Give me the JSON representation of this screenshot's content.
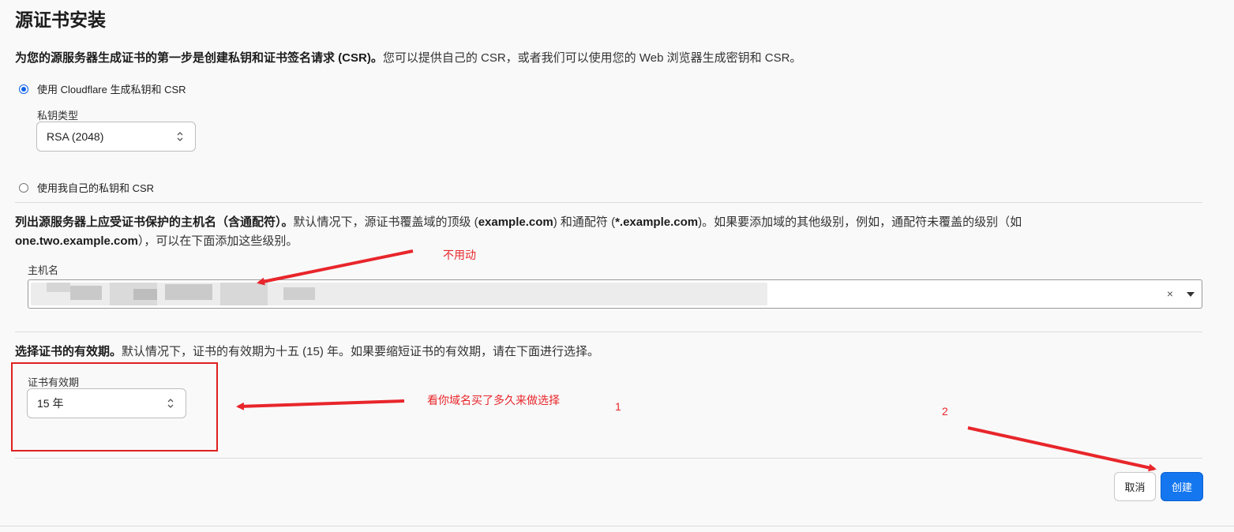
{
  "page": {
    "title": "源证书安装"
  },
  "csr_section": {
    "desc_bold": "为您的源服务器生成证书的第一步是创建私钥和证书签名请求 (CSR)。",
    "desc_rest": "您可以提供自己的 CSR，或者我们可以使用您的 Web 浏览器生成密钥和 CSR。",
    "option_generate": "使用 Cloudflare 生成私钥和 CSR",
    "option_generate_checked": true,
    "key_type_label": "私钥类型",
    "key_type_value": "RSA (2048)",
    "option_own": "使用我自己的私钥和 CSR",
    "option_own_checked": false
  },
  "hostname_section": {
    "desc_bold": "列出源服务器上应受证书保护的主机名（含通配符）。",
    "desc_rest_1": "默认情况下，源证书覆盖域的顶级 (",
    "example_root": "example.com",
    "desc_rest_2": ") 和通配符 (",
    "example_wildcard": "*.example.com",
    "desc_rest_3": ")。如果要添加域的其他级别，例如，通配符未覆盖的级别（如",
    "example_sub": "one.two.example.com",
    "desc_rest_4": "），可以在下面添加这些级别。",
    "field_label": "主机名",
    "clear_glyph": "×"
  },
  "validity_section": {
    "desc_bold": "选择证书的有效期。",
    "desc_rest": "默认情况下，证书的有效期为十五 (15) 年。如果要缩短证书的有效期，请在下面进行选择。",
    "field_label": "证书有效期",
    "value": "15 年"
  },
  "actions": {
    "cancel_label": "取消",
    "create_label": "创建"
  },
  "annotations": {
    "hostname_note": "不用动",
    "validity_note": "看你域名买了多久来做选择",
    "step_1": "1",
    "step_2": "2",
    "color": "#e8262b"
  }
}
